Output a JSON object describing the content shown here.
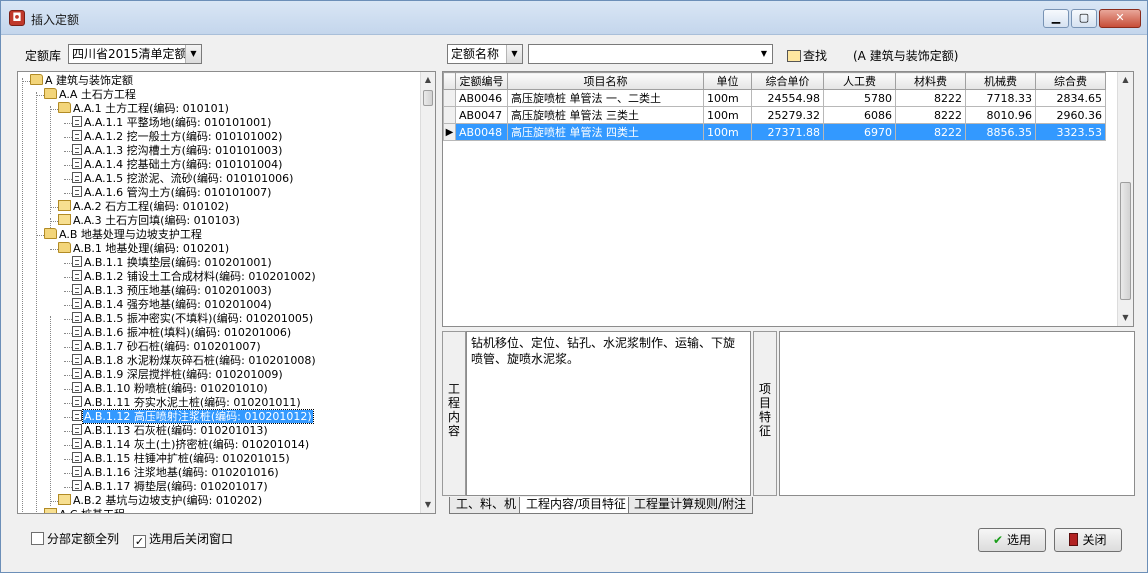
{
  "window": {
    "title": "插入定额"
  },
  "toolbar": {
    "library_label": "定额库",
    "library_value": "四川省2015清单定额",
    "search_field_value": "定额名称",
    "search_input_value": "",
    "find_label": "查找",
    "current_section": "(A 建筑与装饰定额)"
  },
  "tree": {
    "items": [
      {
        "label": "A 建筑与装饰定额"
      },
      {
        "label": "A.A 土石方工程"
      },
      {
        "label": "A.A.1 土方工程(编码: 010101)"
      },
      {
        "label": "A.A.1.1 平整场地(编码: 010101001)"
      },
      {
        "label": "A.A.1.2 挖一般土方(编码: 010101002)"
      },
      {
        "label": "A.A.1.3 挖沟槽土方(编码: 010101003)"
      },
      {
        "label": "A.A.1.4 挖基础土方(编码: 010101004)"
      },
      {
        "label": "A.A.1.5 挖淤泥、流砂(编码: 010101006)"
      },
      {
        "label": "A.A.1.6 管沟土方(编码: 010101007)"
      },
      {
        "label": "A.A.2 石方工程(编码: 010102)"
      },
      {
        "label": "A.A.3 土石方回填(编码: 010103)"
      },
      {
        "label": "A.B 地基处理与边坡支护工程"
      },
      {
        "label": "A.B.1 地基处理(编码: 010201)"
      },
      {
        "label": "A.B.1.1 换填垫层(编码: 010201001)"
      },
      {
        "label": "A.B.1.2 铺设土工合成材料(编码: 010201002)"
      },
      {
        "label": "A.B.1.3 预压地基(编码: 010201003)"
      },
      {
        "label": "A.B.1.4 强夯地基(编码: 010201004)"
      },
      {
        "label": "A.B.1.5 振冲密实(不填料)(编码: 010201005)"
      },
      {
        "label": "A.B.1.6 振冲桩(填料)(编码: 010201006)"
      },
      {
        "label": "A.B.1.7 砂石桩(编码: 010201007)"
      },
      {
        "label": "A.B.1.8 水泥粉煤灰碎石桩(编码: 010201008)"
      },
      {
        "label": "A.B.1.9 深层搅拌桩(编码: 010201009)"
      },
      {
        "label": "A.B.1.10 粉喷桩(编码: 010201010)"
      },
      {
        "label": "A.B.1.11 夯实水泥土桩(编码: 010201011)"
      },
      {
        "label": "A.B.1.12 高压喷射注浆桩(编码: 010201012)"
      },
      {
        "label": "A.B.1.13 石灰桩(编码: 010201013)"
      },
      {
        "label": "A.B.1.14 灰土(土)挤密桩(编码: 010201014)"
      },
      {
        "label": "A.B.1.15 柱锤冲扩桩(编码: 010201015)"
      },
      {
        "label": "A.B.1.16 注浆地基(编码: 010201016)"
      },
      {
        "label": "A.B.1.17 褥垫层(编码: 010201017)"
      },
      {
        "label": "A.B.2 基坑与边坡支护(编码: 010202)"
      },
      {
        "label": "A.C 桩基工程"
      }
    ]
  },
  "grid": {
    "columns": [
      "定额编号",
      "项目名称",
      "单位",
      "综合单价",
      "人工费",
      "材料费",
      "机械费",
      "综合费"
    ],
    "rows": [
      {
        "indicator": "",
        "cells": [
          "AB0046",
          "高压旋喷桩 单管法 一、二类土",
          "100m",
          "24554.98",
          "5780",
          "8222",
          "7718.33",
          "2834.65"
        ]
      },
      {
        "indicator": "",
        "cells": [
          "AB0047",
          "高压旋喷桩 单管法 三类土",
          "100m",
          "25279.32",
          "6086",
          "8222",
          "8010.96",
          "2960.36"
        ]
      },
      {
        "indicator": "▶",
        "cells": [
          "AB0048",
          "高压旋喷桩 单管法 四类土",
          "100m",
          "27371.88",
          "6970",
          "8222",
          "8856.35",
          "3323.53"
        ]
      }
    ]
  },
  "detail": {
    "work_content_label": "工程内容",
    "work_content_text": "钻机移位、定位、钻孔、水泥浆制作、运输、下旋喷管、旋喷水泥浆。",
    "feature_label": "项目特征",
    "feature_text": ""
  },
  "tabs": [
    "工、料、机",
    "工程内容/项目特征",
    "工程量计算规则/附注"
  ],
  "footer": {
    "show_all_label": "分部定额全列",
    "close_after_select_label": "选用后关闭窗口",
    "select_button": "选用",
    "close_button": "关闭"
  }
}
